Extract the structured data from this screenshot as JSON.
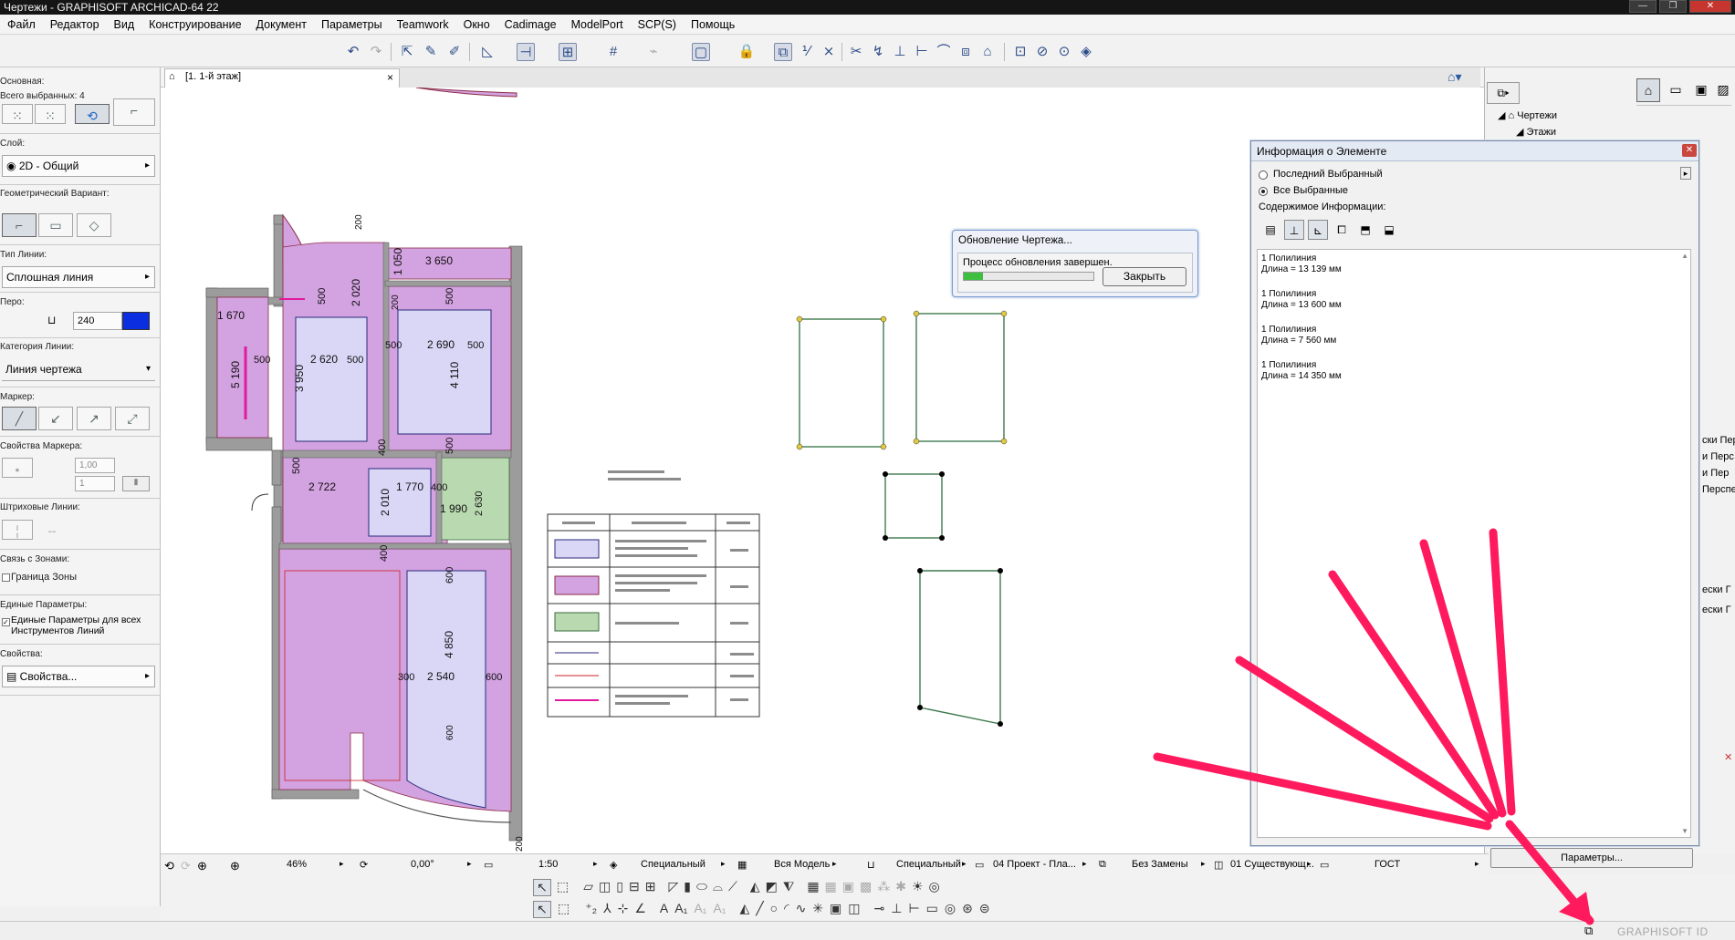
{
  "window": {
    "title": "Чертежи - GRAPHISOFT ARCHICAD-64 22"
  },
  "menu": [
    "Файл",
    "Редактор",
    "Вид",
    "Конструирование",
    "Документ",
    "Параметры",
    "Teamwork",
    "Окно",
    "Cadimage",
    "ModelPort",
    "SCP(S)",
    "Помощь"
  ],
  "infobox": {
    "main_label": "Основная:",
    "selected_label": "Всего выбранных: 4",
    "layer_label": "Слой:",
    "layer_value": "2D - Общий",
    "geom_label": "Геометрический Вариант:",
    "linetype_label": "Тип Линии:",
    "linetype_value": "Сплошная линия",
    "pen_label": "Перо:",
    "pen_value": "240",
    "linecat_label": "Категория Линии:",
    "linecat_value": "Линия чертежа",
    "marker_label": "Маркер:",
    "marker_props_label": "Свойства Маркера:",
    "marker_val1": "1,00",
    "marker_val2": "1",
    "dashed_label": "Штриховые Линии:",
    "zones_label": "Связь с Зонами:",
    "zone_border": "Граница Зоны",
    "unified_label": "Единые Параметры:",
    "unified_text": "Единые Параметры для всех Инструментов Линий",
    "props_label": "Свойства:",
    "props_value": "Свойства..."
  },
  "tab": {
    "label": "[1. 1-й этаж]",
    "close": "×"
  },
  "plan_dims": {
    "d3650": "3 650",
    "d1050": "1 050",
    "d200a": "200",
    "d2020": "2 020",
    "d200b": "200",
    "d500a": "500",
    "d1670": "1 670",
    "d500b": "500",
    "d2620": "2 620",
    "d500c": "500",
    "d500d": "500",
    "d2690": "2 690",
    "d500e": "500",
    "d5190": "5 190",
    "d3950": "3 950",
    "d4110": "4 110",
    "d400a": "400",
    "d500f": "500",
    "d2722": "2 722",
    "d1770": "1 770",
    "d400b": "400",
    "d500g": "500",
    "d2010": "2 010",
    "d1990": "1 990",
    "d2630": "2 630",
    "d400c": "400",
    "d600a": "600",
    "d4850": "4 850",
    "d300": "300",
    "d2540": "2 540",
    "d600b": "600",
    "d600c": "600",
    "d200c": "200"
  },
  "progress_dialog": {
    "title": "Обновление Чертежа...",
    "message": "Процесс обновления завершен.",
    "progress": 0.15,
    "close_label": "Закрыть"
  },
  "info_dialog": {
    "title": "Информация о Элементе",
    "radio_last": "Последний Выбранный",
    "radio_all": "Все Выбранные",
    "content_label": "Содержимое Информации:",
    "items": [
      {
        "name": "1 Полилиния",
        "length": "Длина = 13 139 мм"
      },
      {
        "name": "1 Полилиния",
        "length": "Длина = 13 600 мм"
      },
      {
        "name": "1 Полилиния",
        "length": "Длина = 7 560 мм"
      },
      {
        "name": "1 Полилиния",
        "length": "Длина = 14 350 мм"
      }
    ]
  },
  "navigator": {
    "root": "Чертежи",
    "child": "Этажи",
    "partial_rows": [
      "ски Пер",
      "и Перс",
      "и Пер",
      "Перспе",
      "ески Г",
      "ески Г"
    ]
  },
  "params_button": "Параметры...",
  "statusbar": {
    "zoom": "46%",
    "angle": "0,00°",
    "scale": "1:50",
    "layer_combo": "Специальный",
    "model": "Вся Модель",
    "pen_set": "Специальный",
    "proj": "04 Проект - Пла...",
    "override": "Без Замены",
    "renovation": "01 Существующ...",
    "dim_std": "ГОСТ"
  },
  "brand": "GRAPHISOFT ID",
  "colors": {
    "accent_arrow": "#ff1a5e",
    "room_purple": "#d3a2e0",
    "room_green": "#b9dab0",
    "room_blue": "#d9d6f6",
    "wall_gray": "#9c9c9c",
    "polyline_green": "#3e7a4e"
  }
}
